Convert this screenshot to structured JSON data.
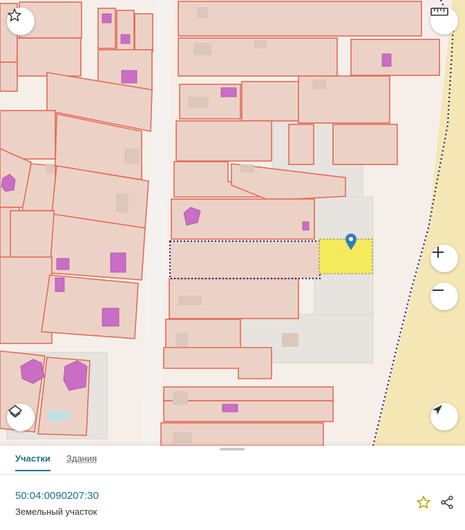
{
  "tabs": [
    {
      "label": "Участки",
      "active": true
    },
    {
      "label": "Здания",
      "active": false
    }
  ],
  "parcel": {
    "cadastral_number": "50:04:0090207:30",
    "type": "Земельный участок"
  },
  "controls": {
    "favorite": "star-icon",
    "ruler": "ruler-icon",
    "zoom_in": "plus-icon",
    "zoom_out": "minus-icon",
    "layers": "layers-icon",
    "locate": "navigation-arrow-icon",
    "share": "share-icon"
  },
  "colors": {
    "parcel_fill": "#ecd2c6",
    "parcel_stroke": "#e26a58",
    "building": "#c96ec4",
    "selected_parcel": "#f4ea5c",
    "boundary": "#2b2b7a",
    "accent": "#1f6f8b",
    "sand": "#f5e7b5"
  }
}
